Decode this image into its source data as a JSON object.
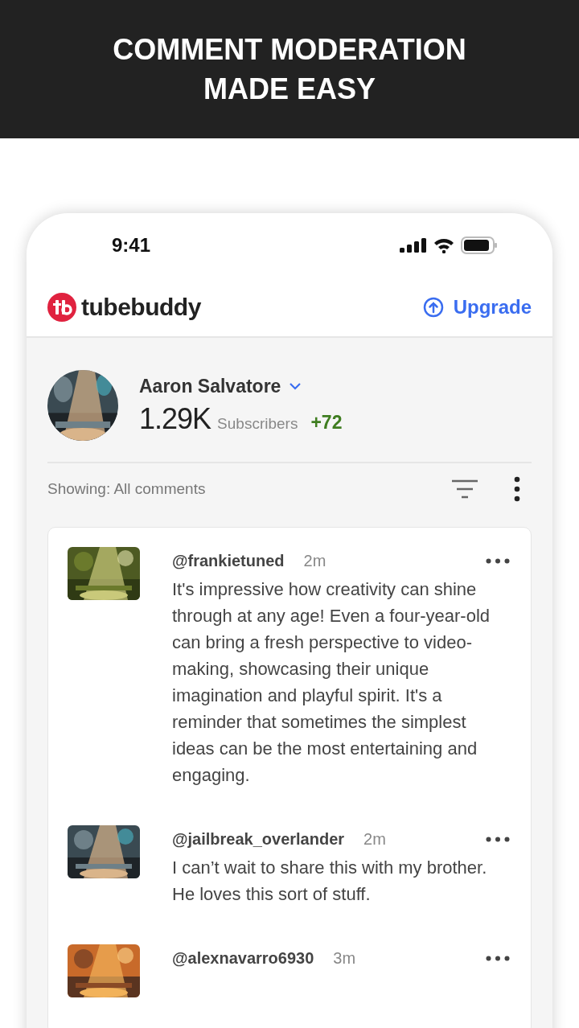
{
  "banner": {
    "title_lines": [
      "COMMENT MODERATION",
      "MADE EASY"
    ]
  },
  "status_bar": {
    "time": "9:41"
  },
  "header": {
    "logo_text": "tubebuddy",
    "upgrade_label": "Upgrade"
  },
  "profile": {
    "name": "Aaron Salvatore",
    "subscriber_count": "1.29K",
    "subscriber_label": "Subscribers",
    "change": "+72"
  },
  "filter": {
    "label": "Showing: All comments"
  },
  "comments": [
    {
      "author": "@frankietuned",
      "time": "2m",
      "text": "It's impressive how creativity can shine through at any age! Even a four-year-old can bring a fresh perspective to video-making, showcasing their unique imagination and playful spirit. It's a reminder that sometimes the simplest ideas can be the most entertaining and engaging."
    },
    {
      "author": "@jailbreak_overlander",
      "time": "2m",
      "text": "I can’t wait to share this with my brother. He loves this sort of stuff."
    },
    {
      "author": "@alexnavarro6930",
      "time": "3m"
    }
  ]
}
